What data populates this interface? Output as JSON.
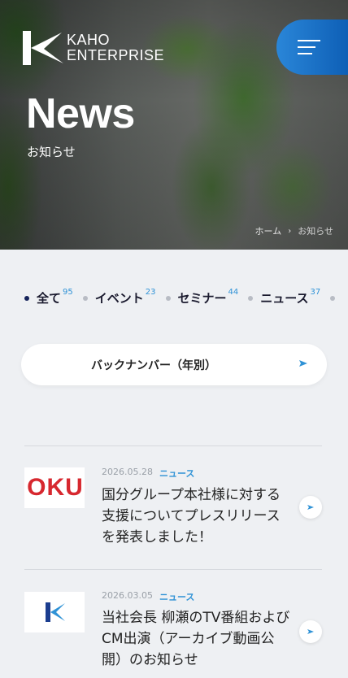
{
  "header": {
    "logo_line1": "KAHO",
    "logo_line2": "ENTERPRISE",
    "menu_icon": "hamburger-menu-icon"
  },
  "hero": {
    "title": "News",
    "subtitle": "お知らせ",
    "breadcrumb": [
      "ホーム",
      "お知らせ"
    ]
  },
  "filters": [
    {
      "label": "全て",
      "count": "95",
      "active": true
    },
    {
      "label": "イベント",
      "count": "23",
      "active": false
    },
    {
      "label": "セミナー",
      "count": "44",
      "active": false
    },
    {
      "label": "ニュース",
      "count": "37",
      "active": false
    }
  ],
  "backnumber": {
    "label": "バックナンバー（年別）",
    "icon": "arrow-right-icon"
  },
  "news": [
    {
      "date": "2026.05.28",
      "category": "ニュース",
      "title": "国分グループ本社様に対する支援についてプレスリリースを発表しました！",
      "thumb_text": "OKU"
    },
    {
      "date": "2026.03.05",
      "category": "ニュース",
      "title": "当社会長 柳瀬のTV番組およびCM出演（アーカイブ動画公開）のお知らせ"
    }
  ],
  "colors": {
    "accent": "#2f92d6",
    "menu": "#1a73c8",
    "dark": "#15235a",
    "kokubu_red": "#d7282f"
  }
}
